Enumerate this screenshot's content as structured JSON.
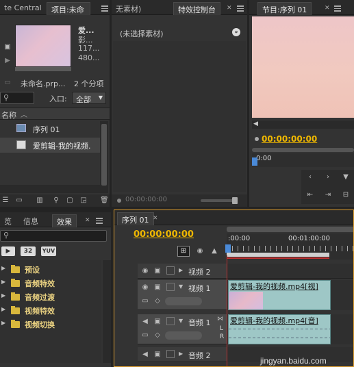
{
  "project_panel": {
    "tab_left": "te Central",
    "tab_project": "项目:未命",
    "clip_name": "爱...",
    "clip_type": "影...",
    "clip_size": "117...",
    "clip_res": "480...",
    "project_file": "未命名.prp...",
    "item_count": "2 个分项",
    "entry_label": "入口:",
    "entry_value": "全部",
    "column_name": "名称",
    "items": [
      {
        "label": "序列 01"
      },
      {
        "label": "爱剪辑-我的视频."
      }
    ]
  },
  "source_panel": {
    "tab_source": "无素材)",
    "tab_effect_controls": "特效控制台",
    "no_selection": "(未选择素材)",
    "timecode": "00:00:00:00"
  },
  "program_panel": {
    "tab": "节目:序列 01",
    "timecode": "00:00:00:00",
    "ruler_label": "0:00"
  },
  "effects_panel": {
    "tab_preview": "览",
    "tab_info": "信息",
    "tab_effects": "效果",
    "badge_32": "32",
    "badge_yuv": "YUV",
    "folders": [
      {
        "label": "预设"
      },
      {
        "label": "音频特效"
      },
      {
        "label": "音频过渡"
      },
      {
        "label": "视频特效"
      },
      {
        "label": "视频切换"
      }
    ]
  },
  "timeline_panel": {
    "tab": "序列 01",
    "timecode": "00:00:00:00",
    "ruler_start": ":00:00",
    "ruler_mid": "00:01:00:00",
    "tracks": {
      "video2": "视频 2",
      "video1": "视频 1",
      "audio1": "音频 1",
      "audio2": "音频 2"
    },
    "video_clip_title": "爱剪辑-我的视频.mp4[视]",
    "audio_clip_title": "爱剪辑-我的视频.mp4[音]",
    "audio_channel_l": "L",
    "audio_channel_r": "R"
  },
  "watermark": "jingyan.baidu.com",
  "colors": {
    "accent_timecode": "#f0b800",
    "panel_bg": "#333333",
    "clip": "#9ec7c6"
  }
}
